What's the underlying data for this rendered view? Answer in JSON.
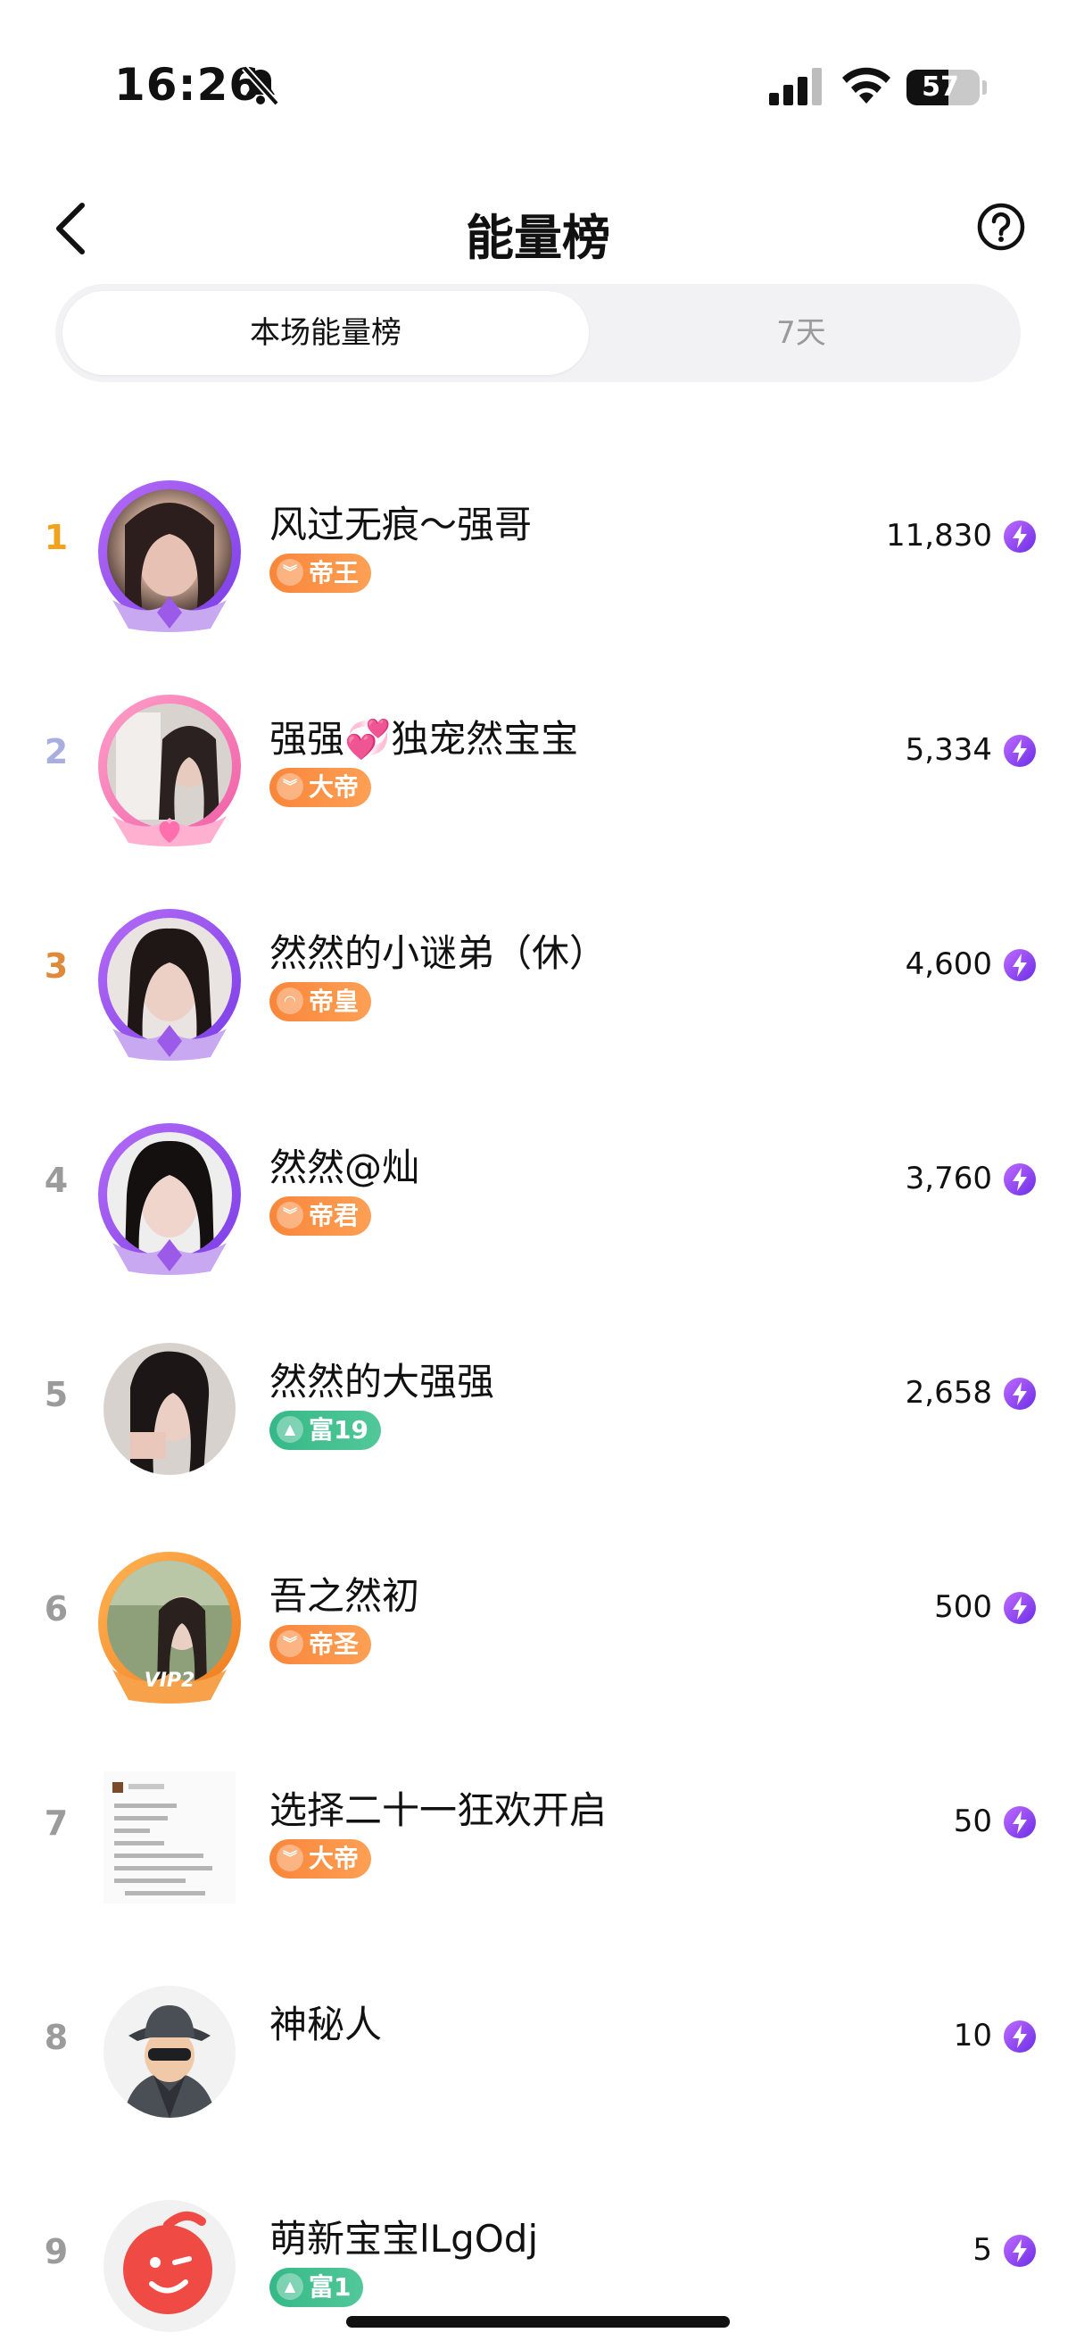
{
  "status_bar": {
    "time": "16:26",
    "battery": "57",
    "battery_level": 0.57
  },
  "header": {
    "title": "能量榜"
  },
  "tabs": [
    {
      "label": "本场能量榜",
      "active": true
    },
    {
      "label": "7天",
      "active": false
    }
  ],
  "leaderboard": [
    {
      "rank": "1",
      "name": "风过无痕～强哥",
      "badge": "帝王",
      "score": "11,830"
    },
    {
      "rank": "2",
      "name": "强强💞独宠然宝宝",
      "badge": "大帝",
      "score": "5,334"
    },
    {
      "rank": "3",
      "name": "然然的小谜弟（休）",
      "badge": "帝皇",
      "score": "4,600"
    },
    {
      "rank": "4",
      "name": "然然@灿",
      "badge": "帝君",
      "score": "3,760"
    },
    {
      "rank": "5",
      "name": "然然的大强强",
      "badge": "富19",
      "score": "2,658"
    },
    {
      "rank": "6",
      "name": "吾之然初",
      "badge": "帝圣",
      "score": "500",
      "avatar_frame_text": "VIP2"
    },
    {
      "rank": "7",
      "name": "选择二十一狂欢开启",
      "badge": "大帝",
      "score": "50"
    },
    {
      "rank": "8",
      "name": "神秘人",
      "badge": "",
      "score": "10"
    },
    {
      "rank": "9",
      "name": "萌新宝宝lLgOdj",
      "badge": "富1",
      "score": "5"
    }
  ],
  "colors": {
    "rank_gold": "#f1a31b",
    "rank_silver": "#a9aee0",
    "rank_bronze": "#df8a3b",
    "rank_default": "#9b9b9b",
    "badge_orange": "#f8863a",
    "badge_green": "#35b887",
    "energy": "#8a3cf0"
  }
}
